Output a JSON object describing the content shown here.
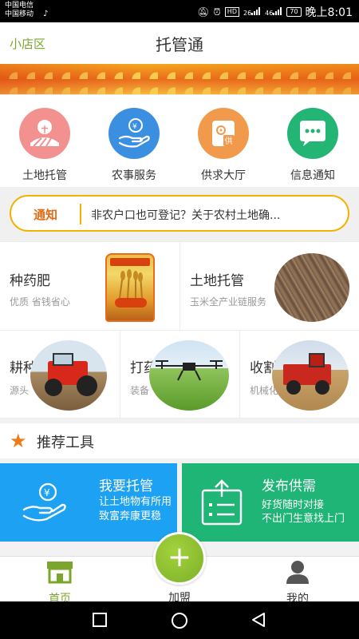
{
  "status_bar": {
    "carrier1": "中国电信",
    "carrier2": "中国移动",
    "hd": "HD",
    "net1": "26",
    "net2": "46",
    "battery": "70",
    "time": "晚上8:01"
  },
  "header": {
    "left_link": "小店区",
    "title": "托管通"
  },
  "categories": [
    {
      "label": "土地托管",
      "icon": "farmland-icon",
      "color": "#f08a8a"
    },
    {
      "label": "农事服务",
      "icon": "hand-coin-icon",
      "color": "#3b8fe0"
    },
    {
      "label": "供求大厅",
      "icon": "supply-demand-icon",
      "color": "#f29a4c"
    },
    {
      "label": "信息通知",
      "icon": "chat-bubble-icon",
      "color": "#22b573"
    }
  ],
  "notice": {
    "tag": "通知",
    "text": "非农户口也可登记？关于农村土地确..."
  },
  "products_row1": [
    {
      "title": "种药肥",
      "subtitle": "优质 省钱省心"
    },
    {
      "title": "土地托管",
      "subtitle": "玉米全产业链服务"
    }
  ],
  "products_row2": [
    {
      "title": "耕种",
      "subtitle": "源头"
    },
    {
      "title": "打药",
      "subtitle": "装备"
    },
    {
      "title": "收割",
      "subtitle": "机械化服务"
    }
  ],
  "tools": {
    "title": "推荐工具",
    "items": [
      {
        "title": "我要托管",
        "line1": "让土地物有所用",
        "line2": "致富奔康更稳",
        "color": "#1da1f2"
      },
      {
        "title": "发布供需",
        "line1": "好货随时对接",
        "line2": "不出门生意找上门",
        "color": "#1fb576"
      }
    ]
  },
  "bottom_nav": {
    "home": "首页",
    "join": "加盟",
    "me": "我的",
    "active_color": "#7ba62b"
  }
}
